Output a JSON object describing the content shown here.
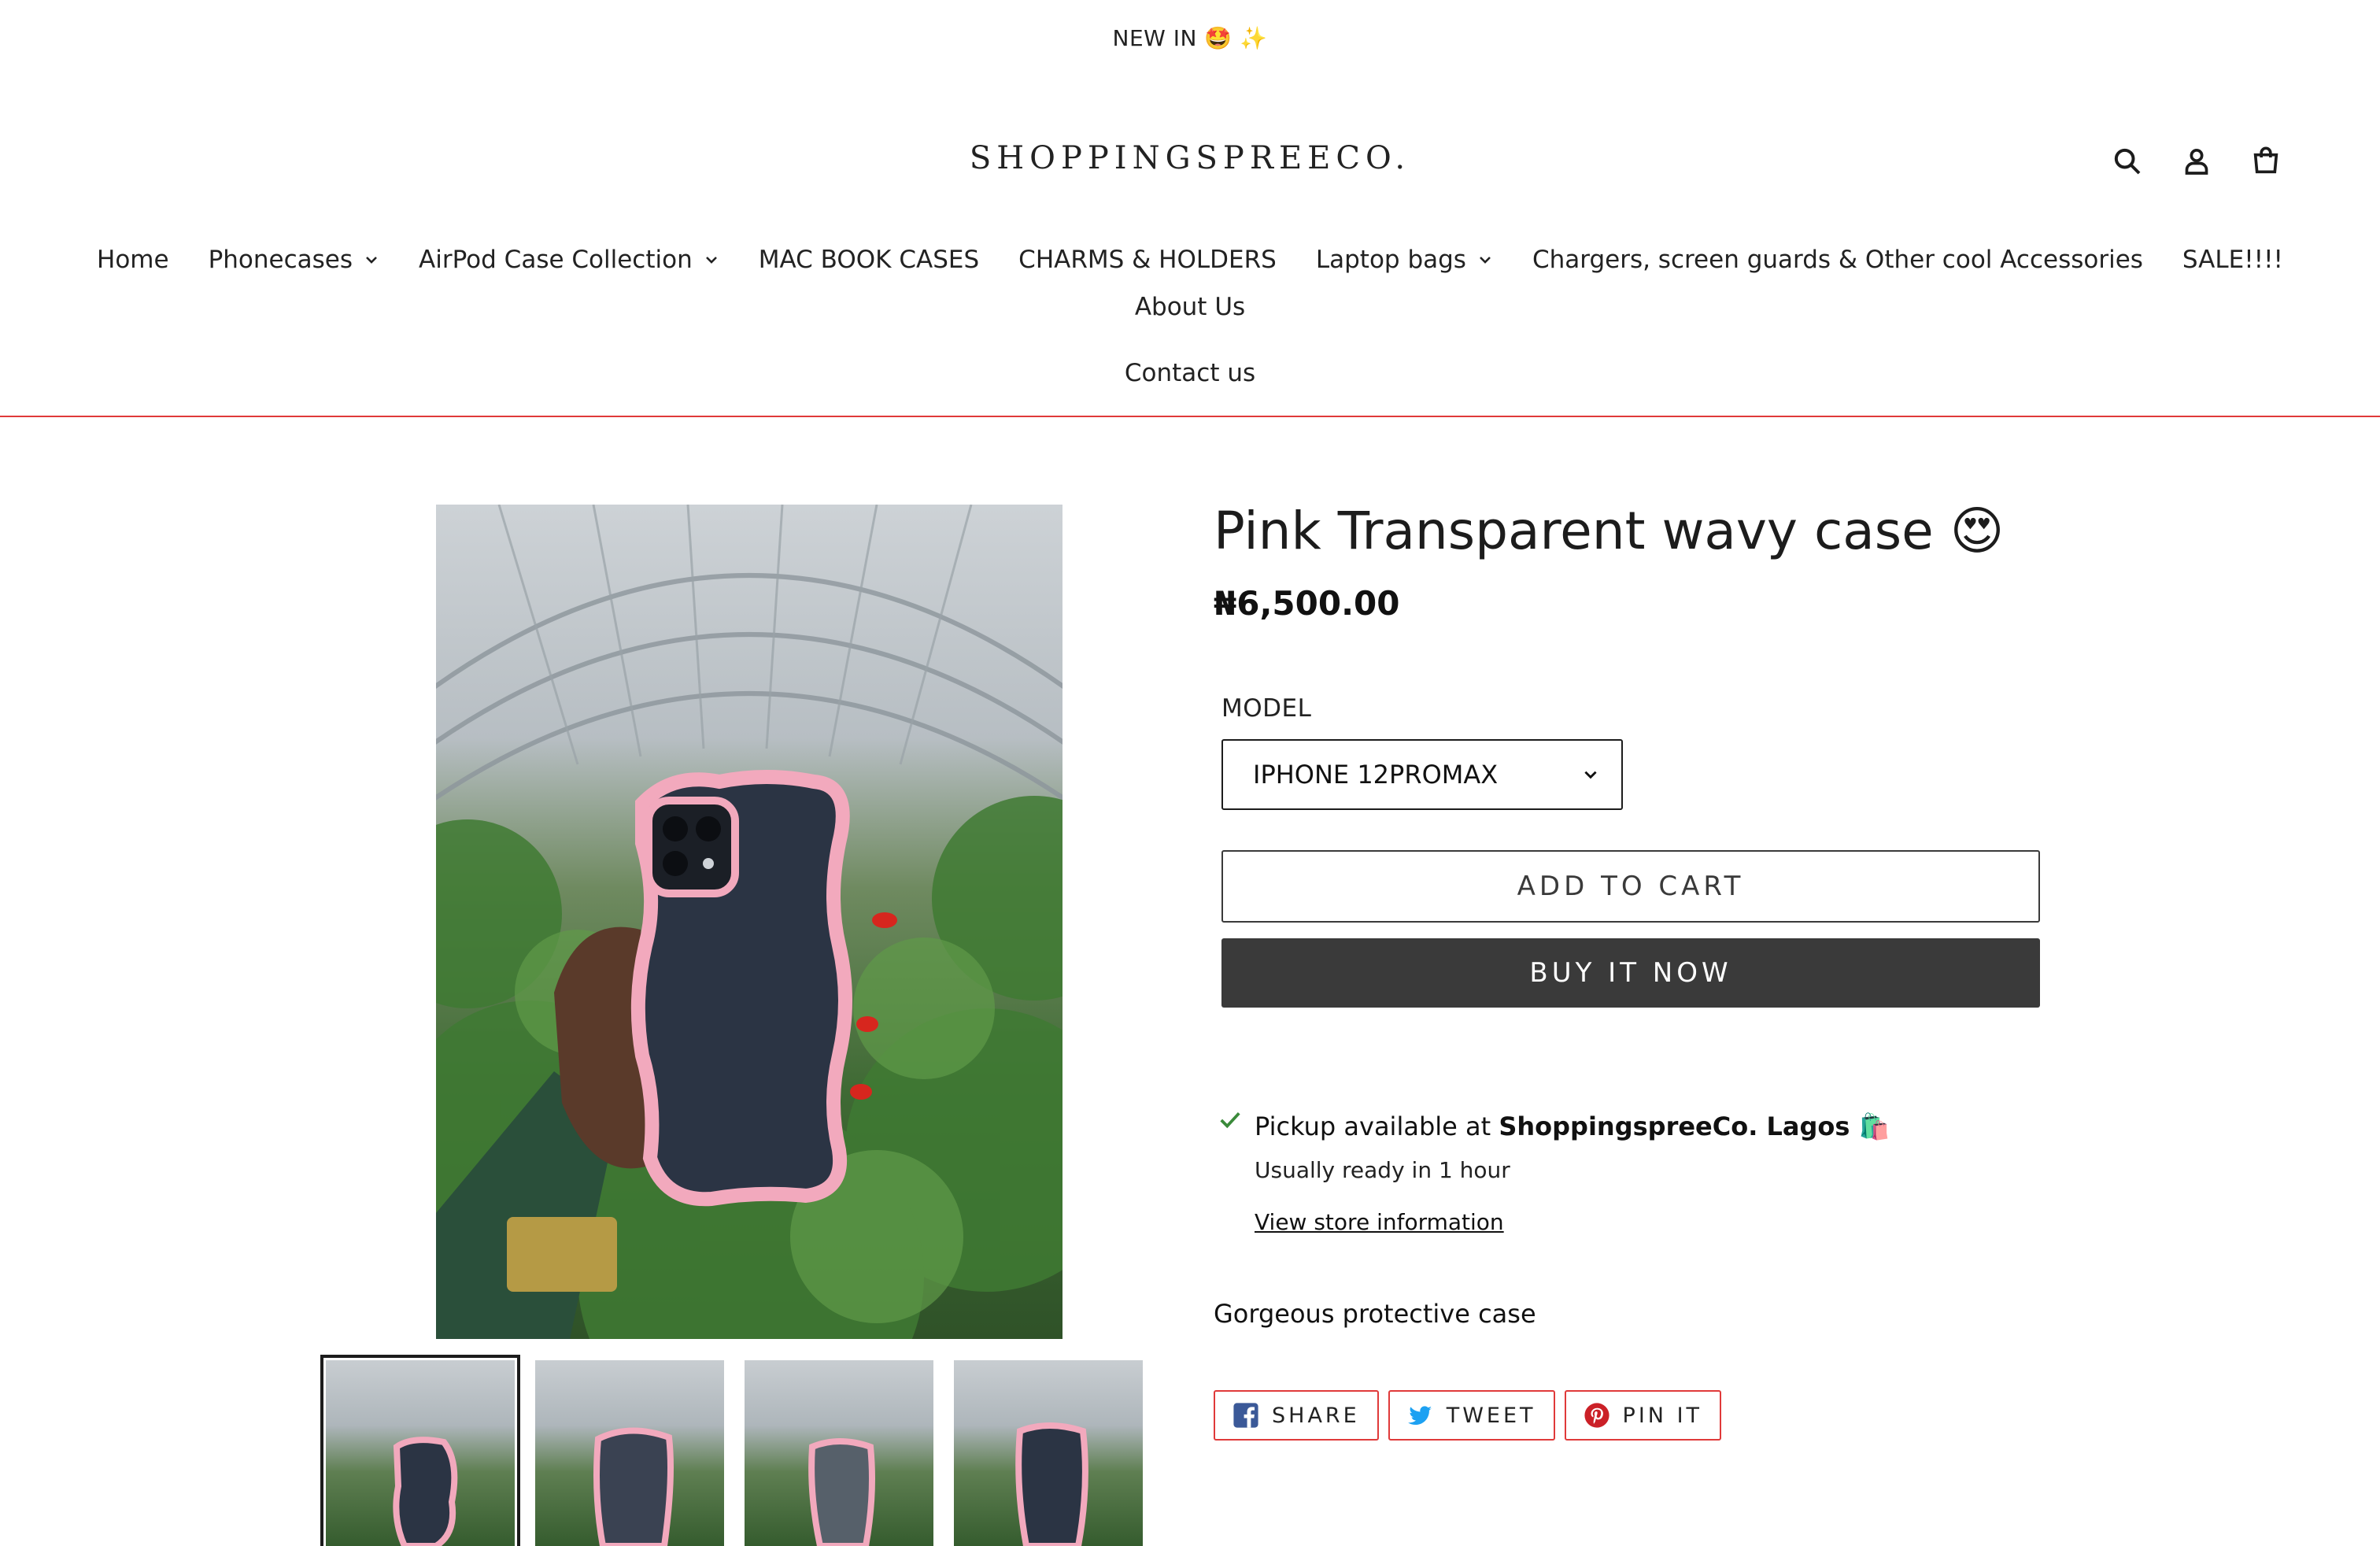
{
  "announcement": "NEW IN 🤩 ✨",
  "brand": {
    "logo_text": "SHOPPINGSPREECO."
  },
  "header_icons": [
    "search-icon",
    "account-icon",
    "cart-icon"
  ],
  "nav": {
    "items": [
      {
        "label": "Home",
        "has_dropdown": false
      },
      {
        "label": "Phonecases",
        "has_dropdown": true
      },
      {
        "label": "AirPod Case Collection",
        "has_dropdown": true
      },
      {
        "label": "MAC BOOK CASES",
        "has_dropdown": false
      },
      {
        "label": "CHARMS & HOLDERS",
        "has_dropdown": false
      },
      {
        "label": "Laptop bags",
        "has_dropdown": true
      },
      {
        "label": "Chargers, screen guards & Other cool Accessories",
        "has_dropdown": false
      },
      {
        "label": "SALE!!!!",
        "has_dropdown": false
      },
      {
        "label": "About Us",
        "has_dropdown": false
      },
      {
        "label": "Contact us",
        "has_dropdown": false
      }
    ]
  },
  "colors": {
    "accent": "#e03a3a",
    "button_dark": "#3a3a3a",
    "case_pink": "#f2a9bd",
    "check_green": "#3a8a3a"
  },
  "product": {
    "title": "Pink Transparent wavy case 😍",
    "price": "₦6,500.00",
    "model_label": "MODEL",
    "model_selected": "IPHONE 12PROMAX",
    "add_to_cart": "ADD TO CART",
    "buy_now": "BUY IT NOW",
    "description": "Gorgeous protective  case"
  },
  "pickup": {
    "prefix": "Pickup available at ",
    "store": "ShoppingspreeCo. Lagos 🛍️",
    "ready": "Usually ready in 1 hour",
    "link": "View store information"
  },
  "share": [
    {
      "label": "SHARE",
      "icon": "facebook-icon"
    },
    {
      "label": "TWEET",
      "icon": "twitter-icon"
    },
    {
      "label": "PIN IT",
      "icon": "pinterest-icon"
    }
  ],
  "gallery": {
    "thumbnail_count": 4,
    "active_index": 0
  }
}
